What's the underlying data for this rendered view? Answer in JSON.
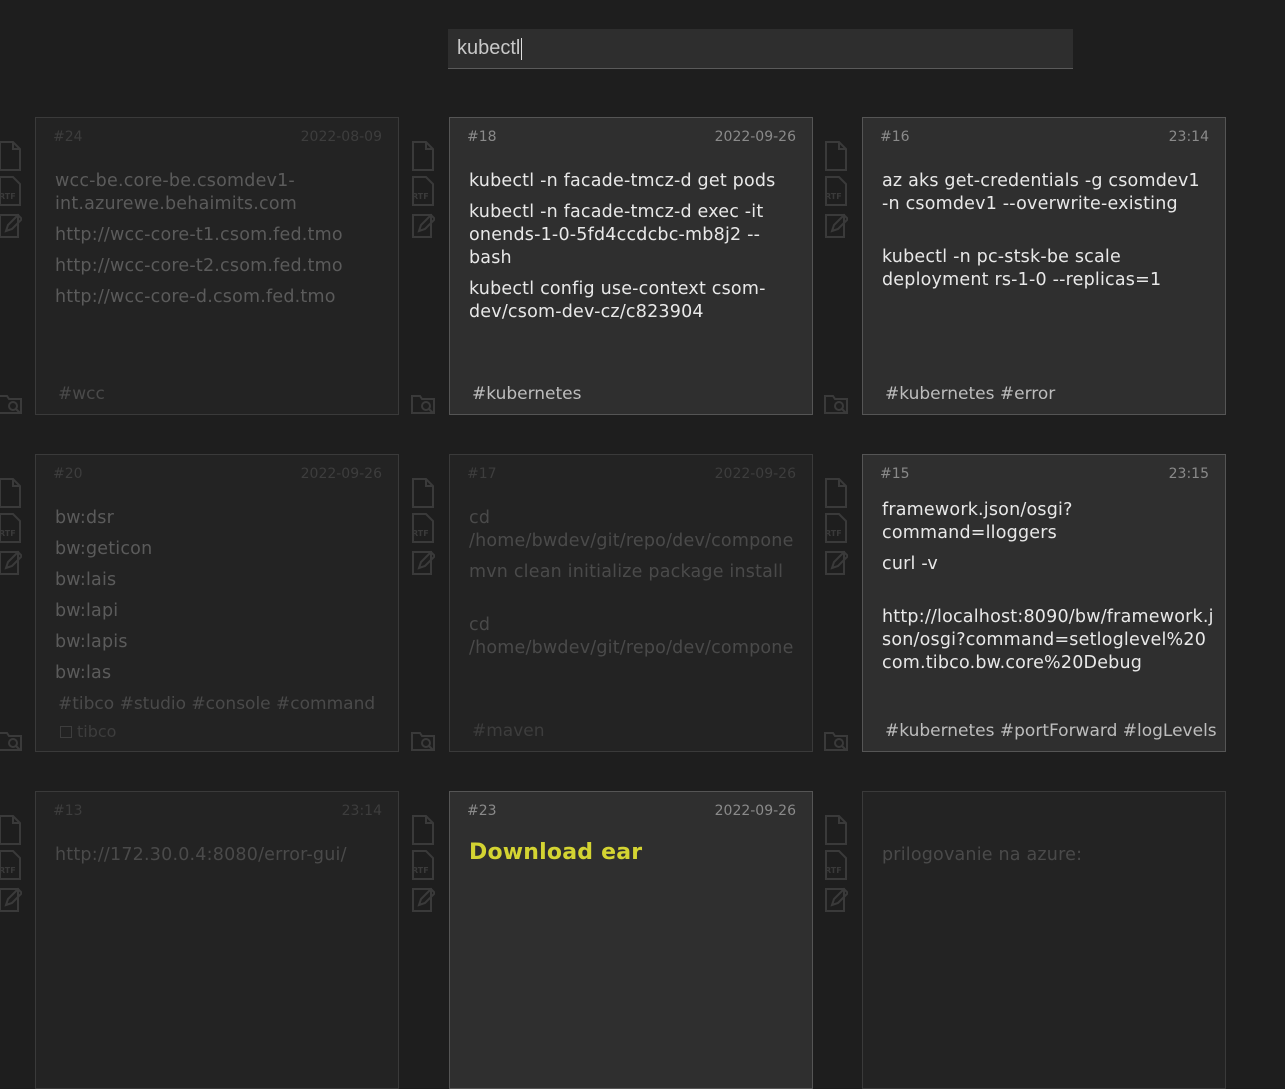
{
  "search": {
    "value": "kubectl"
  },
  "side_icons": [
    "document-icon",
    "rtf-icon",
    "edit-icon",
    "folder-search-icon"
  ],
  "cards": [
    {
      "num": "#24",
      "date": "2022-08-09",
      "lines": [
        "wcc-be.core-be.csomdev1-int.azurewe.behaimits.com",
        "http://wcc-core-t1.csom.fed.tmo",
        "http://wcc-core-t2.csom.fed.tmo",
        "http://wcc-core-d.csom.fed.tmo"
      ],
      "tags": "#wcc"
    },
    {
      "num": "#18",
      "date": "2022-09-26",
      "lines": [
        "kubectl -n facade-tmcz-d get pods",
        "kubectl -n facade-tmcz-d exec -it onends-1-0-5fd4ccdcbc-mb8j2 -- bash",
        "kubectl config use-context csom-dev/csom-dev-cz/c823904"
      ],
      "tags": "#kubernetes"
    },
    {
      "num": "#16",
      "date": "23:14",
      "lines": [
        "az aks get-credentials -g csomdev1 -n csomdev1 --overwrite-existing",
        "",
        "kubectl -n pc-stsk-be scale deployment rs-1-0 --replicas=1"
      ],
      "tags": "#kubernetes #error"
    },
    {
      "num": "#20",
      "date": "2022-09-26",
      "lines": [
        "bw:dsr",
        "bw:geticon",
        "bw:lais",
        "bw:lapi",
        "bw:lapis",
        "bw:las"
      ],
      "tags": "#tibco #studio #console #command",
      "extra": "tibco"
    },
    {
      "num": "#17",
      "date": "2022-09-26",
      "lines": [
        "cd /home/bwdev/git/repo/dev/components/shared/csom/bw/shared.csom.sm",
        "mvn clean initialize package install",
        "",
        "cd /home/bwdev/git/repo/dev/components/shared/facade/bw/shared.facade.sm"
      ],
      "tags": "#maven"
    },
    {
      "num": "#15",
      "date": "23:15",
      "lines": [
        "framework.json/osgi?command=lloggers",
        "curl -v",
        "",
        "http://localhost:8090/bw/framework.json/osgi?command=setloglevel%20com.tibco.bw.core%20Debug"
      ],
      "tags": "#kubernetes #portForward #logLevels"
    },
    {
      "num": "#13",
      "date": "23:14",
      "lines": [
        "http://172.30.0.4:8080/error-gui/"
      ],
      "tags": ""
    },
    {
      "num": "#23",
      "date": "2022-09-26",
      "lines": [
        "Download ear"
      ],
      "tags": ""
    },
    {
      "num": "",
      "date": "",
      "lines": [
        "prilogovanie na azure:"
      ],
      "tags": ""
    }
  ]
}
